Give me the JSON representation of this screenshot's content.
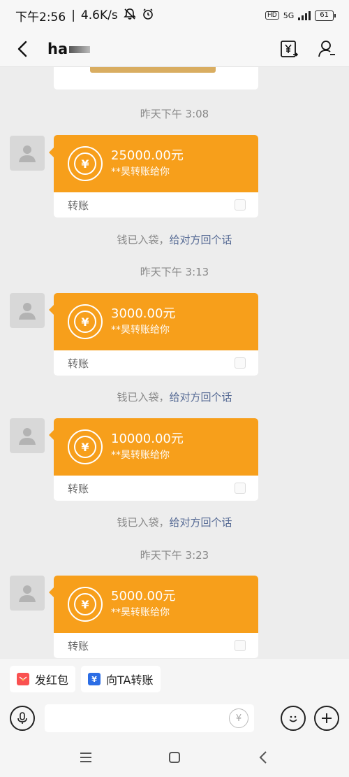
{
  "status_bar": {
    "time": "下午2:56",
    "speed": "4.6K/s",
    "hd": "HD",
    "network": "5G",
    "battery": "61"
  },
  "header": {
    "title": "ha"
  },
  "messages": [
    {
      "timestamp": "昨天下午 3:08",
      "amount": "25000.00元",
      "from": "**昊转账给你",
      "label": "转账",
      "notice": "钱已入袋，",
      "notice_link": "给对方回个话"
    },
    {
      "timestamp": "昨天下午 3:13",
      "amount": "3000.00元",
      "from": "**昊转账给你",
      "label": "转账",
      "notice": "钱已入袋，",
      "notice_link": "给对方回个话"
    },
    {
      "timestamp": "",
      "amount": "10000.00元",
      "from": "**昊转账给你",
      "label": "转账",
      "notice": "钱已入袋，",
      "notice_link": "给对方回个话"
    },
    {
      "timestamp": "昨天下午 3:23",
      "amount": "5000.00元",
      "from": "**昊转账给你",
      "label": "转账",
      "notice": "",
      "notice_link": ""
    }
  ],
  "quick_actions": {
    "red_packet": "发红包",
    "transfer": "向TA转账"
  },
  "colors": {
    "transfer_orange": "#f79f1b",
    "link_blue": "#576b95",
    "red_packet": "#fa5151",
    "transfer_blue": "#2b6de5"
  }
}
